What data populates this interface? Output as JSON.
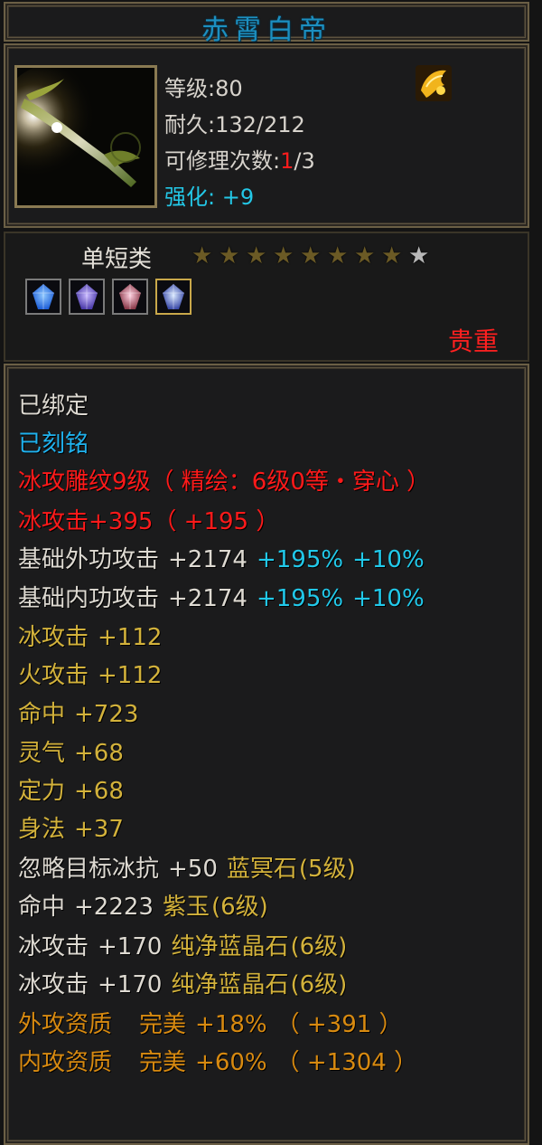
{
  "title": "赤霄白帝",
  "stats": {
    "level_label": "等级:",
    "level_value": "80",
    "durability_label": "耐久:",
    "durability_value": "132/212",
    "repair_label": "可修理次数:",
    "repair_used": "1",
    "repair_total": "/3",
    "enhance_label": "强化:",
    "enhance_value": "+9"
  },
  "category": "单短类",
  "stars": {
    "filled": 8,
    "total": 9
  },
  "gems": [
    "blue-crystal-gem",
    "purple-crystal-gem",
    "pink-crystal-gem",
    "ice-crystal-gem"
  ],
  "badge_icon": "golden-charm-icon",
  "rarity": "贵重",
  "attributes": {
    "bound": "已绑定",
    "engraved": "已刻铭",
    "carving": "冰攻雕纹9级（ 精绘：6级0等・穿心 ）",
    "ice_attack_engraved": "冰攻击+395（ +195 ）",
    "ext_attack": {
      "label": "基础外功攻击",
      "value": "+2174",
      "pct1": "+195%",
      "pct2": "+10%"
    },
    "int_attack": {
      "label": "基础内功攻击",
      "value": "+2174",
      "pct1": "+195%",
      "pct2": "+10%"
    },
    "ice_attack": {
      "label": "冰攻击",
      "value": "+112"
    },
    "fire_attack": {
      "label": "火攻击",
      "value": "+112"
    },
    "hit": {
      "label": "命中",
      "value": "+723"
    },
    "spirit": {
      "label": "灵气",
      "value": "+68"
    },
    "focus": {
      "label": "定力",
      "value": "+68"
    },
    "agility": {
      "label": "身法",
      "value": "+37"
    },
    "gem1": {
      "label": "忽略目标冰抗",
      "value": "+50",
      "gem": "蓝冥石",
      "level": "(5级)"
    },
    "gem2": {
      "label": "命中",
      "value": "+2223",
      "gem": "紫玉",
      "level": "(6级)"
    },
    "gem3": {
      "label": "冰攻击",
      "value": "+170",
      "gem": "纯净蓝晶石",
      "level": "(6级)"
    },
    "gem4": {
      "label": "冰攻击",
      "value": "+170",
      "gem": "纯净蓝晶石",
      "level": "(6级)"
    },
    "ext_quality": {
      "label": "外攻资质",
      "grade": "完美",
      "pct": "+18%",
      "bonus": "（ +391 ）"
    },
    "int_quality": {
      "label": "内攻资质",
      "grade": "完美",
      "pct": "+60%",
      "bonus": "（ +1304 ）"
    }
  },
  "colors": {
    "title": "#1c8fc0",
    "enhance": "#23c7e6",
    "engraved": "#1fb2ee",
    "red": "#ff1a1a",
    "yellow": "#d3b23b",
    "orange": "#d88a10",
    "cyan": "#21c9ea"
  }
}
